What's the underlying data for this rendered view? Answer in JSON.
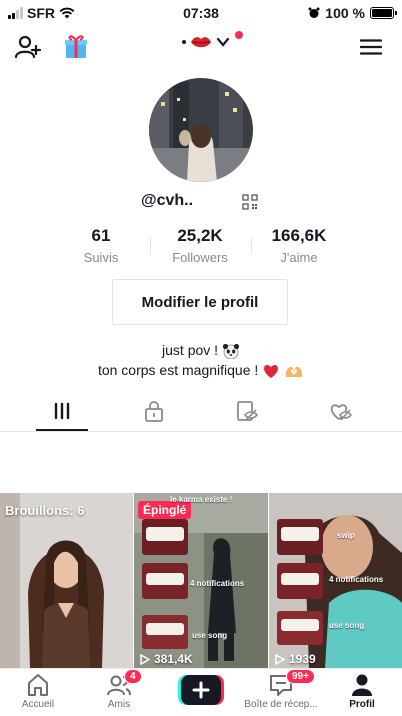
{
  "status_bar": {
    "carrier": "SFR",
    "time": "07:38",
    "battery": "100 %"
  },
  "top_bar": {
    "add_friend_icon": "add-user-icon",
    "gift_icon": "gift-box-icon",
    "account_icon": "lips-emoji-icon",
    "menu_icon": "hamburger-menu-icon",
    "accent": "#fe2c55"
  },
  "profile": {
    "username": "@cvh..",
    "stats": [
      {
        "value": "61",
        "label": "Suivis"
      },
      {
        "value": "25,2K",
        "label": "Followers"
      },
      {
        "value": "166,6K",
        "label": "J'aime"
      }
    ],
    "edit_button": "Modifier le profil",
    "bio_line1": "just pov !",
    "bio_line2": "ton corps est magnifique !"
  },
  "tabs": [
    {
      "name": "videos-tab",
      "icon": "grid-bars-icon",
      "active": true
    },
    {
      "name": "private-tab",
      "icon": "lock-icon",
      "active": false
    },
    {
      "name": "reposts-tab",
      "icon": "eye-off-icon",
      "active": false
    },
    {
      "name": "liked-tab",
      "icon": "heart-off-icon",
      "active": false
    }
  ],
  "videos": [
    {
      "label": "Brouillons: 6",
      "views": ""
    },
    {
      "label": "Épinglé",
      "views": "381,4K",
      "caption_top": "le karma existe !",
      "caption_mid": "4 notifications",
      "caption_bottom": "use song"
    },
    {
      "label": "",
      "views": "1939",
      "caption_top": "swip",
      "caption_mid": "4 notifications",
      "caption_bottom": "use song"
    }
  ],
  "bottom_nav": [
    {
      "label": "Accueil",
      "icon": "home-icon"
    },
    {
      "label": "Amis",
      "icon": "friends-icon",
      "badge": "4"
    },
    {
      "label": "",
      "icon": "plus-icon"
    },
    {
      "label": "Boîte de récep...",
      "icon": "inbox-icon",
      "badge": "99+"
    },
    {
      "label": "Profil",
      "icon": "profile-icon"
    }
  ]
}
